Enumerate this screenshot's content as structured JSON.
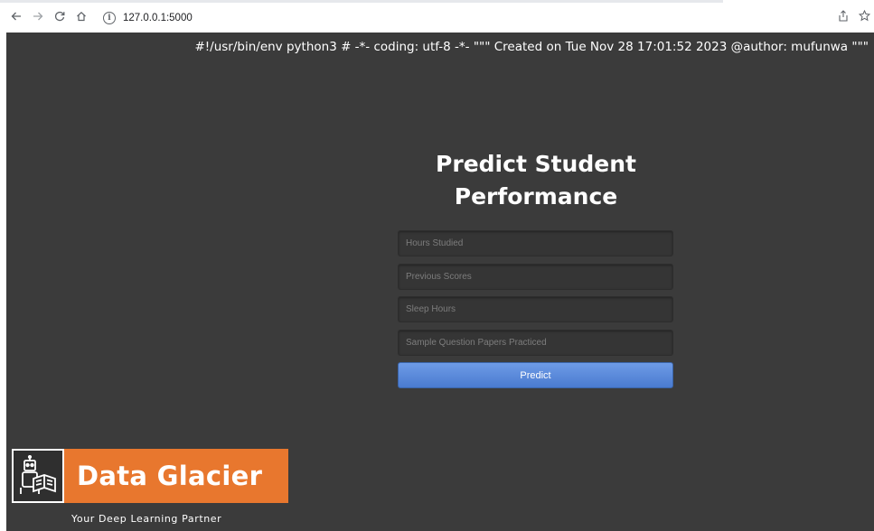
{
  "browser": {
    "url": "127.0.0.1:5000"
  },
  "page": {
    "code_header": "#!/usr/bin/env python3 # -*- coding: utf-8 -*- \"\"\" Created on Tue Nov 28 17:01:52 2023 @author: mufunwa \"\"\"",
    "title": "Predict Student Performance",
    "form": {
      "fields": [
        {
          "placeholder": "Hours Studied"
        },
        {
          "placeholder": "Previous Scores"
        },
        {
          "placeholder": "Sleep Hours"
        },
        {
          "placeholder": "Sample Question Papers Practiced"
        }
      ],
      "submit_label": "Predict"
    },
    "logo": {
      "name": "Data Glacier",
      "tagline": "Your Deep Learning Partner"
    }
  },
  "colors": {
    "page_background": "#3b3b3b",
    "button_blue": "#5a8ade",
    "logo_orange": "#e8772e"
  },
  "icons": {
    "back": "arrow-left-icon",
    "forward": "arrow-right-icon",
    "reload": "reload-icon",
    "home": "home-icon",
    "site_info": "info-icon",
    "share": "share-icon",
    "bookmark": "star-icon"
  }
}
